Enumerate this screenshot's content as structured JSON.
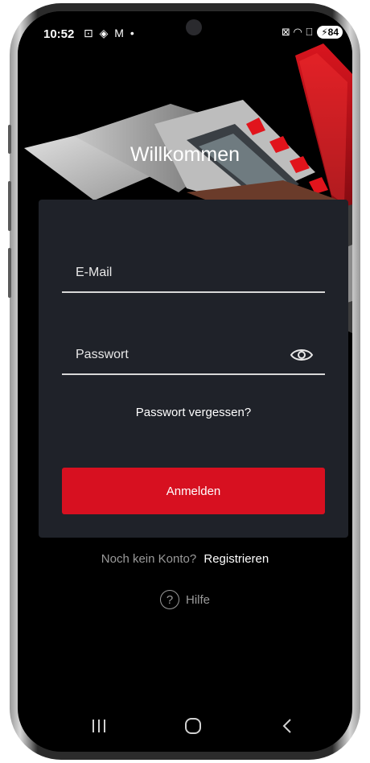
{
  "status_bar": {
    "time": "10:52",
    "left_icons": "⊡ ◈ M •",
    "right_icons": "⊠ ◠ ⃠",
    "battery": "84"
  },
  "header": {
    "title": "Willkommen"
  },
  "login_form": {
    "email_label": "E-Mail",
    "password_label": "Passwort",
    "forgot_password": "Passwort vergessen?",
    "submit_label": "Anmelden"
  },
  "register": {
    "prompt": "Noch kein Konto?",
    "link": "Registrieren"
  },
  "help": {
    "icon_glyph": "?",
    "label": "Hilfe"
  },
  "colors": {
    "background": "#000000",
    "card": "#1f2229",
    "accent": "#d71020",
    "muted_text": "#9a9a9a"
  },
  "icons": {
    "password_toggle": "eye-icon",
    "help": "question-circle-icon",
    "nav_recent": "recent-apps-icon",
    "nav_home": "home-icon",
    "nav_back": "back-icon"
  }
}
